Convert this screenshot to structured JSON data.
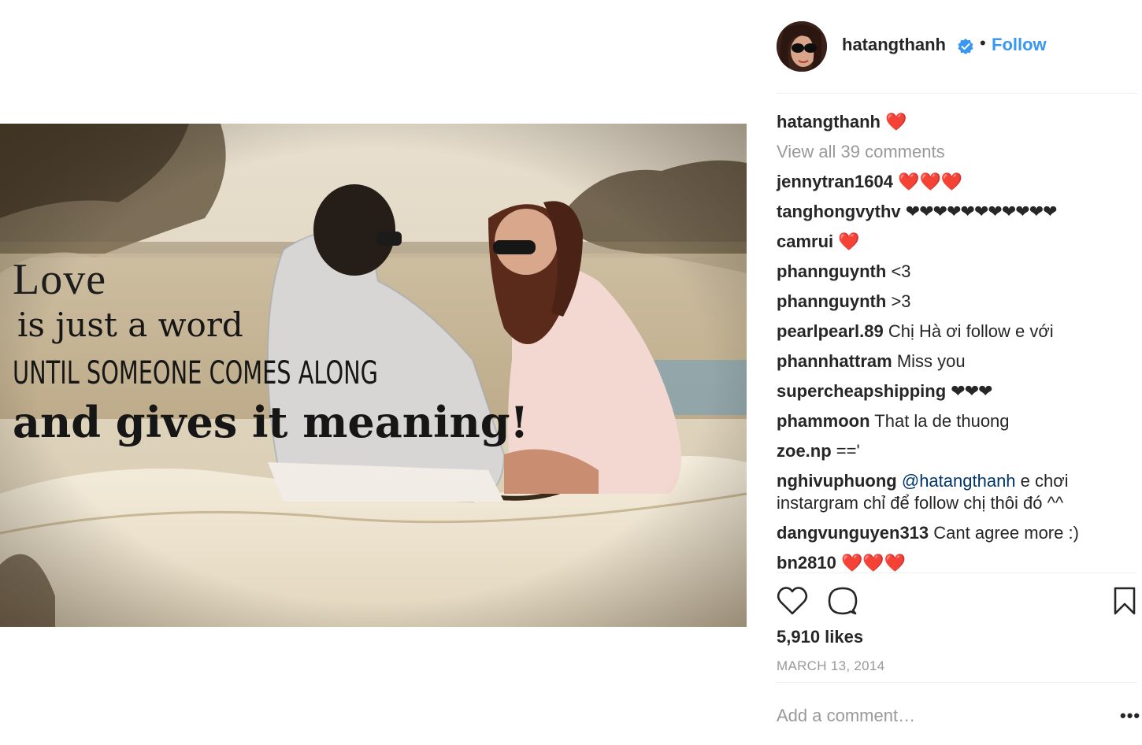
{
  "post": {
    "image_alt": "couple in vintage convertible car",
    "quote": {
      "line1": "Love",
      "line2": "is just a word",
      "line3": "UNTIL SOMEONE COMES ALONG",
      "line4": "and gives it meaning!"
    }
  },
  "header": {
    "username": "hatangthanh",
    "verified_icon": "verified-badge-icon",
    "separator": "•",
    "follow_label": "Follow"
  },
  "caption": {
    "user": "hatangthanh",
    "text": "❤️"
  },
  "view_all": "View all 39 comments",
  "comments": [
    {
      "user": "jennytran1604",
      "text": "❤️❤️❤️"
    },
    {
      "user": "tanghongvythv",
      "text": "❤❤❤❤❤❤❤❤❤❤❤"
    },
    {
      "user": "camrui",
      "text": "❤️"
    },
    {
      "user": "phannguynth",
      "text": "<3"
    },
    {
      "user": "phannguynth",
      "text": ">3"
    },
    {
      "user": "pearlpearl.89",
      "text": "Chị Hà ơi follow e với"
    },
    {
      "user": "phannhattram",
      "text": "Miss you"
    },
    {
      "user": "supercheapshipping",
      "text": "❤❤❤"
    },
    {
      "user": "phammoon",
      "text": "That la de thuong"
    },
    {
      "user": "zoe.np",
      "text": "=='"
    },
    {
      "user": "nghivuphuong",
      "mention": "@hatangthanh",
      "text": "e chơi instargram chỉ để follow chị thôi đó ^^"
    },
    {
      "user": "dangvunguyen313",
      "text": "Cant agree more :)"
    },
    {
      "user": "bn2810",
      "text": "❤️❤️❤️"
    }
  ],
  "actions": {
    "like_icon": "heart-outline-icon",
    "comment_icon": "comment-bubble-icon",
    "save_icon": "bookmark-icon"
  },
  "likes": "5,910 likes",
  "date": "MARCH 13, 2014",
  "add_comment_placeholder": "Add a comment…",
  "more_label": "•••",
  "colors": {
    "link_blue": "#3897f0",
    "mention_blue": "#003569",
    "muted": "#999999",
    "heart_red": "#ed2d35",
    "text": "#262626"
  }
}
